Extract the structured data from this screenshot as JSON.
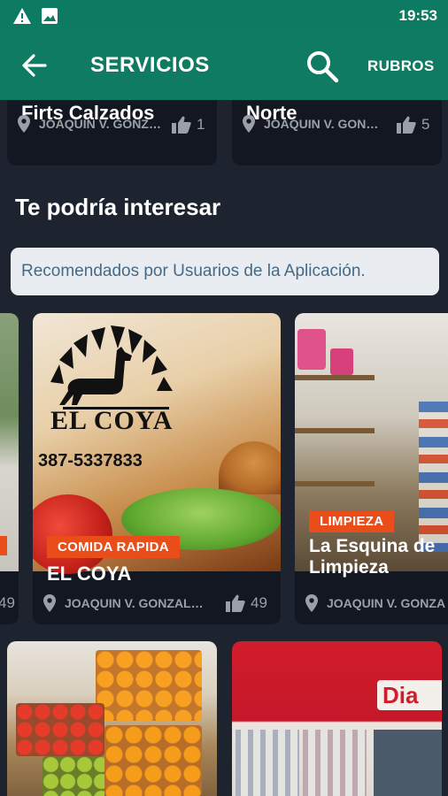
{
  "status_bar": {
    "time": "19:53",
    "icons": [
      "warning-icon",
      "image-icon"
    ]
  },
  "app_bar": {
    "title": "SERVICIOS",
    "rubros_label": "RUBROS"
  },
  "top_cards": [
    {
      "name": "Firts Calzados",
      "location": "JOAQUIN V. GONZ…",
      "likes": "1"
    },
    {
      "name": "Norte",
      "location": "JOAQUIN V. GON…",
      "likes": "5"
    }
  ],
  "section": {
    "title": "Te podría interesar",
    "subtitle": "Recomendados por Usuarios de la Aplicación."
  },
  "featured": [
    {
      "partial_likes": "49"
    },
    {
      "badge": "COMIDA RAPIDA",
      "name": "EL COYA",
      "location": "JOAQUIN V. GONZAL…",
      "likes": "49",
      "logo_text": "EL COYA",
      "phone": "387-5337833"
    },
    {
      "badge": "LIMPIEZA",
      "name": "La Esquina de Limpieza",
      "location": "JOAQUIN V. GONZA"
    }
  ],
  "bottom_cards": [
    {
      "sign_text": "Dia"
    }
  ],
  "colors": {
    "primary": "#0f7b63",
    "badge": "#e84d1a",
    "background": "#1e2330"
  }
}
